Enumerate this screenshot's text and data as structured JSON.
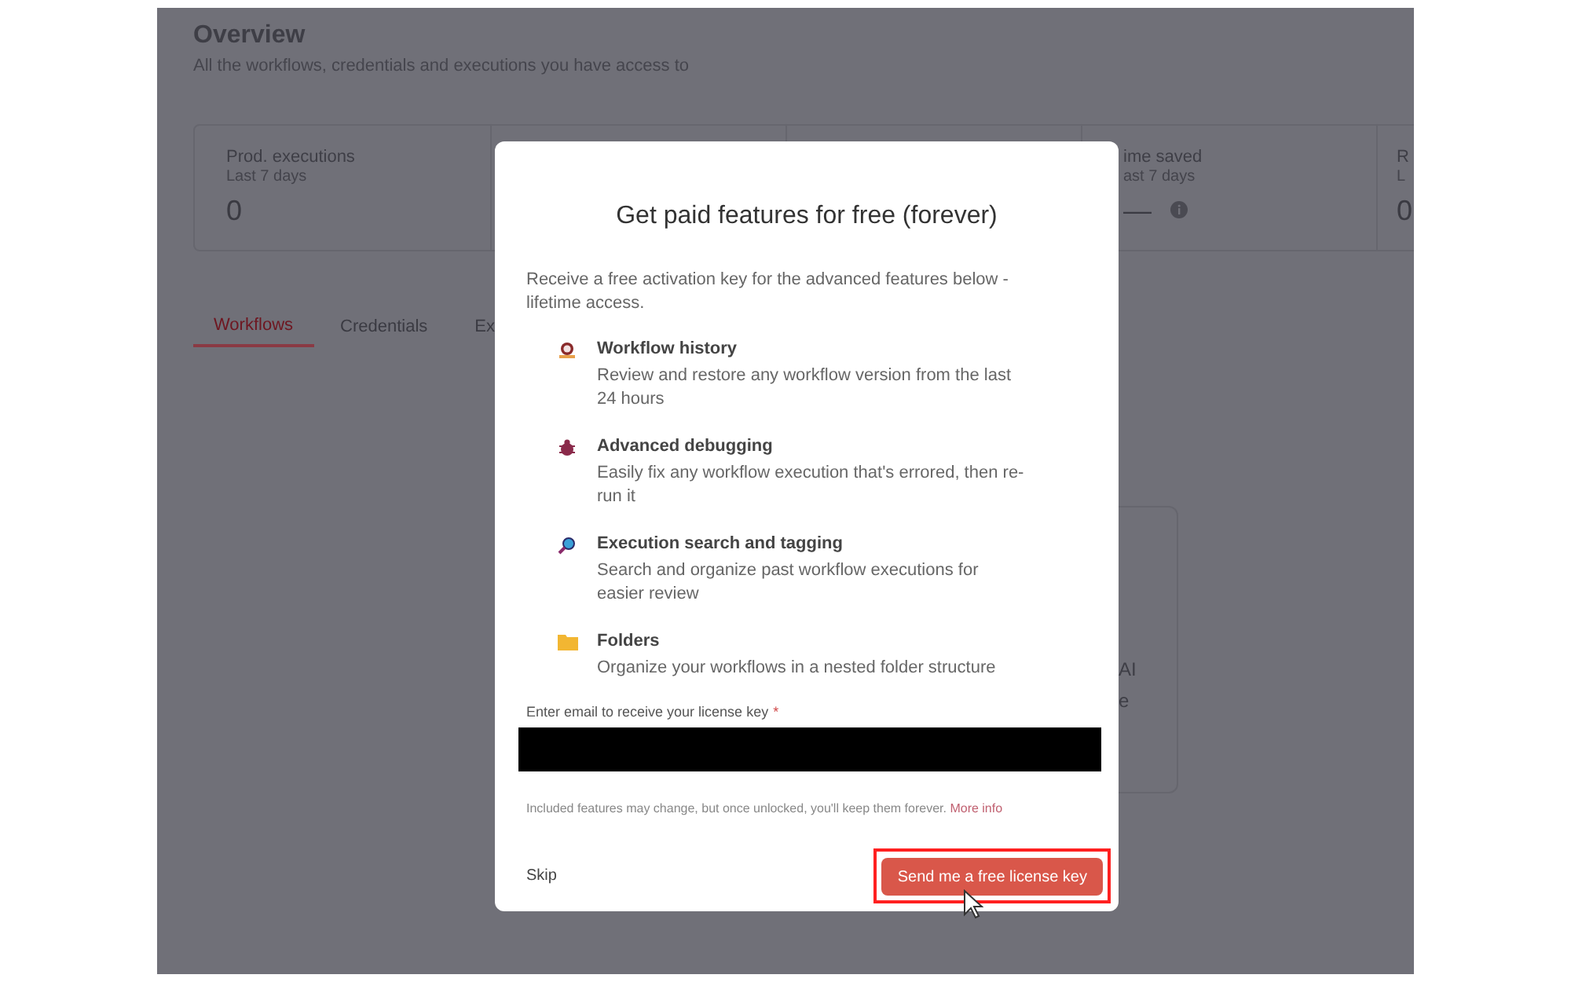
{
  "page": {
    "title": "Overview",
    "subtitle": "All the workflows, credentials and executions you have access to"
  },
  "stats": [
    {
      "label": "Prod. executions",
      "period": "Last 7 days",
      "value": "0"
    },
    {
      "label": "ime saved",
      "period": "ast 7 days",
      "value": "—",
      "info": true
    },
    {
      "label": "R",
      "period": "L",
      "value": "0"
    }
  ],
  "tabs": [
    {
      "label": "Workflows",
      "selected": true
    },
    {
      "label": "Credentials",
      "selected": false
    },
    {
      "label": "Ex",
      "selected": false
    }
  ],
  "card_fragment": [
    "AI",
    "e"
  ],
  "modal": {
    "title": "Get paid features for free (forever)",
    "intro": "Receive a free activation key for the advanced features below - lifetime access.",
    "features": [
      {
        "kind": "history",
        "title": "Workflow history",
        "text": "Review and restore any workflow version from the last 24 hours"
      },
      {
        "kind": "debug",
        "title": "Advanced debugging",
        "text": "Easily fix any workflow execution that's errored, then re-run it"
      },
      {
        "kind": "search",
        "title": "Execution search and tagging",
        "text": "Search and organize past workflow executions for easier review"
      },
      {
        "kind": "folder",
        "title": "Folders",
        "text": "Organize your workflows in a nested folder structure"
      }
    ],
    "email_label": "Enter email to receive your license key",
    "required_mark": "*",
    "note": "Included features may change, but once unlocked, you'll keep them forever.",
    "note_link": "More info",
    "skip": "Skip",
    "submit": "Send me a free license key",
    "submit_highlighted": true
  }
}
